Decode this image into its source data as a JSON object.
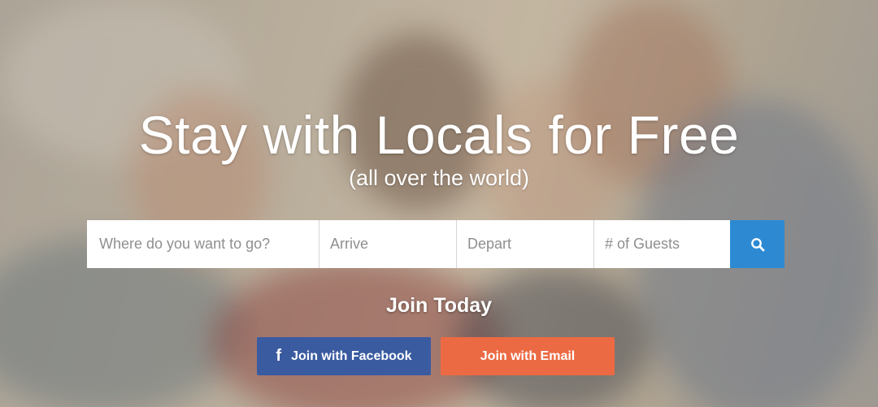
{
  "hero": {
    "title": "Stay with Locals for Free",
    "subtitle": "(all over the world)"
  },
  "search": {
    "where_placeholder": "Where do you want to go?",
    "arrive_placeholder": "Arrive",
    "depart_placeholder": "Depart",
    "guests_placeholder": "# of Guests",
    "button_icon": "search-icon"
  },
  "join": {
    "heading": "Join Today",
    "facebook_label": "Join with Facebook",
    "facebook_icon": "f",
    "email_label": "Join with Email"
  },
  "colors": {
    "search_button": "#2d8ad2",
    "facebook": "#3a5ba0",
    "email": "#ec6a43"
  }
}
